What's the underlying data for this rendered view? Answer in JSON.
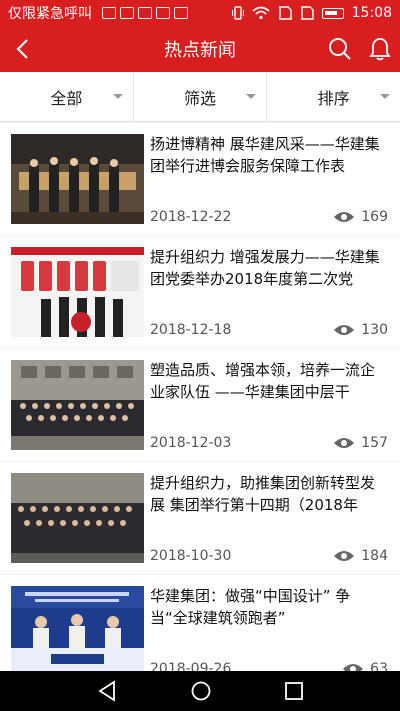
{
  "status_bar": {
    "carrier": "仅限紧急呼叫",
    "time": "15:08"
  },
  "header": {
    "title": "热点新闻",
    "back_icon": "back-arrow-icon",
    "search_icon": "search-icon",
    "bell_icon": "bell-icon"
  },
  "filters": [
    {
      "label": "全部"
    },
    {
      "label": "筛选"
    },
    {
      "label": "排序"
    }
  ],
  "news": [
    {
      "title": "扬进博精神 展华建风采——华建集团举行进博会服务保障工作表",
      "date": "2018-12-22",
      "views": "169"
    },
    {
      "title": "提升组织力 增强发展力——华建集团党委举办2018年度第二次党",
      "date": "2018-12-18",
      "views": "130"
    },
    {
      "title": "塑造品质、增强本领，培养一流企业家队伍 ——华建集团中层干",
      "date": "2018-12-03",
      "views": "157"
    },
    {
      "title": "提升组织力，助推集团创新转型发展 集团举行第十四期（2018年",
      "date": "2018-10-30",
      "views": "184"
    },
    {
      "title": "华建集团：做强“中国设计” 争当“全球建筑领跑者”",
      "date": "2018-09-26",
      "views": "63"
    }
  ],
  "colors": {
    "brand": "#d81e1e"
  }
}
